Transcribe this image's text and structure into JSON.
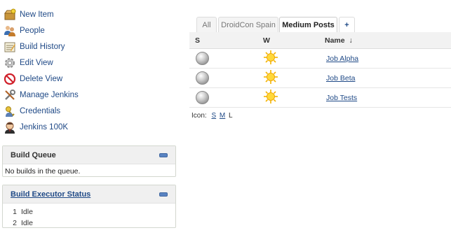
{
  "sidebar": {
    "items": [
      {
        "label": "New Item",
        "icon": "new-item-icon"
      },
      {
        "label": "People",
        "icon": "people-icon"
      },
      {
        "label": "Build History",
        "icon": "build-history-icon"
      },
      {
        "label": "Edit View",
        "icon": "gear-icon"
      },
      {
        "label": "Delete View",
        "icon": "delete-icon"
      },
      {
        "label": "Manage Jenkins",
        "icon": "tools-icon"
      },
      {
        "label": "Credentials",
        "icon": "credentials-icon"
      },
      {
        "label": "Jenkins 100K",
        "icon": "jenkins-avatar-icon"
      }
    ]
  },
  "build_queue": {
    "title": "Build Queue",
    "empty_text": "No builds in the queue."
  },
  "executors": {
    "title": "Build Executor Status",
    "rows": [
      {
        "num": "1",
        "status": "Idle"
      },
      {
        "num": "2",
        "status": "Idle"
      }
    ]
  },
  "tabs": {
    "items": [
      {
        "label": "All"
      },
      {
        "label": "DroidCon Spain"
      },
      {
        "label": "Medium Posts"
      },
      {
        "label": "+"
      }
    ],
    "active": "Medium Posts"
  },
  "table": {
    "headers": {
      "status": "S",
      "weather": "W",
      "name": "Name",
      "sort_arrow": "↓"
    },
    "rows": [
      {
        "name": "Job Alpha",
        "status_icon": "grey-ball-icon",
        "weather_icon": "sunny-icon"
      },
      {
        "name": "Job Beta",
        "status_icon": "grey-ball-icon",
        "weather_icon": "sunny-icon"
      },
      {
        "name": "Job Tests",
        "status_icon": "grey-ball-icon",
        "weather_icon": "sunny-icon"
      }
    ]
  },
  "icon_size": {
    "label": "Icon:",
    "options": [
      "S",
      "M",
      "L"
    ],
    "current": "L"
  },
  "colors": {
    "link": "#204a87",
    "pane_header": "#f0f0f0",
    "collapse_button": "#5a84c2"
  }
}
